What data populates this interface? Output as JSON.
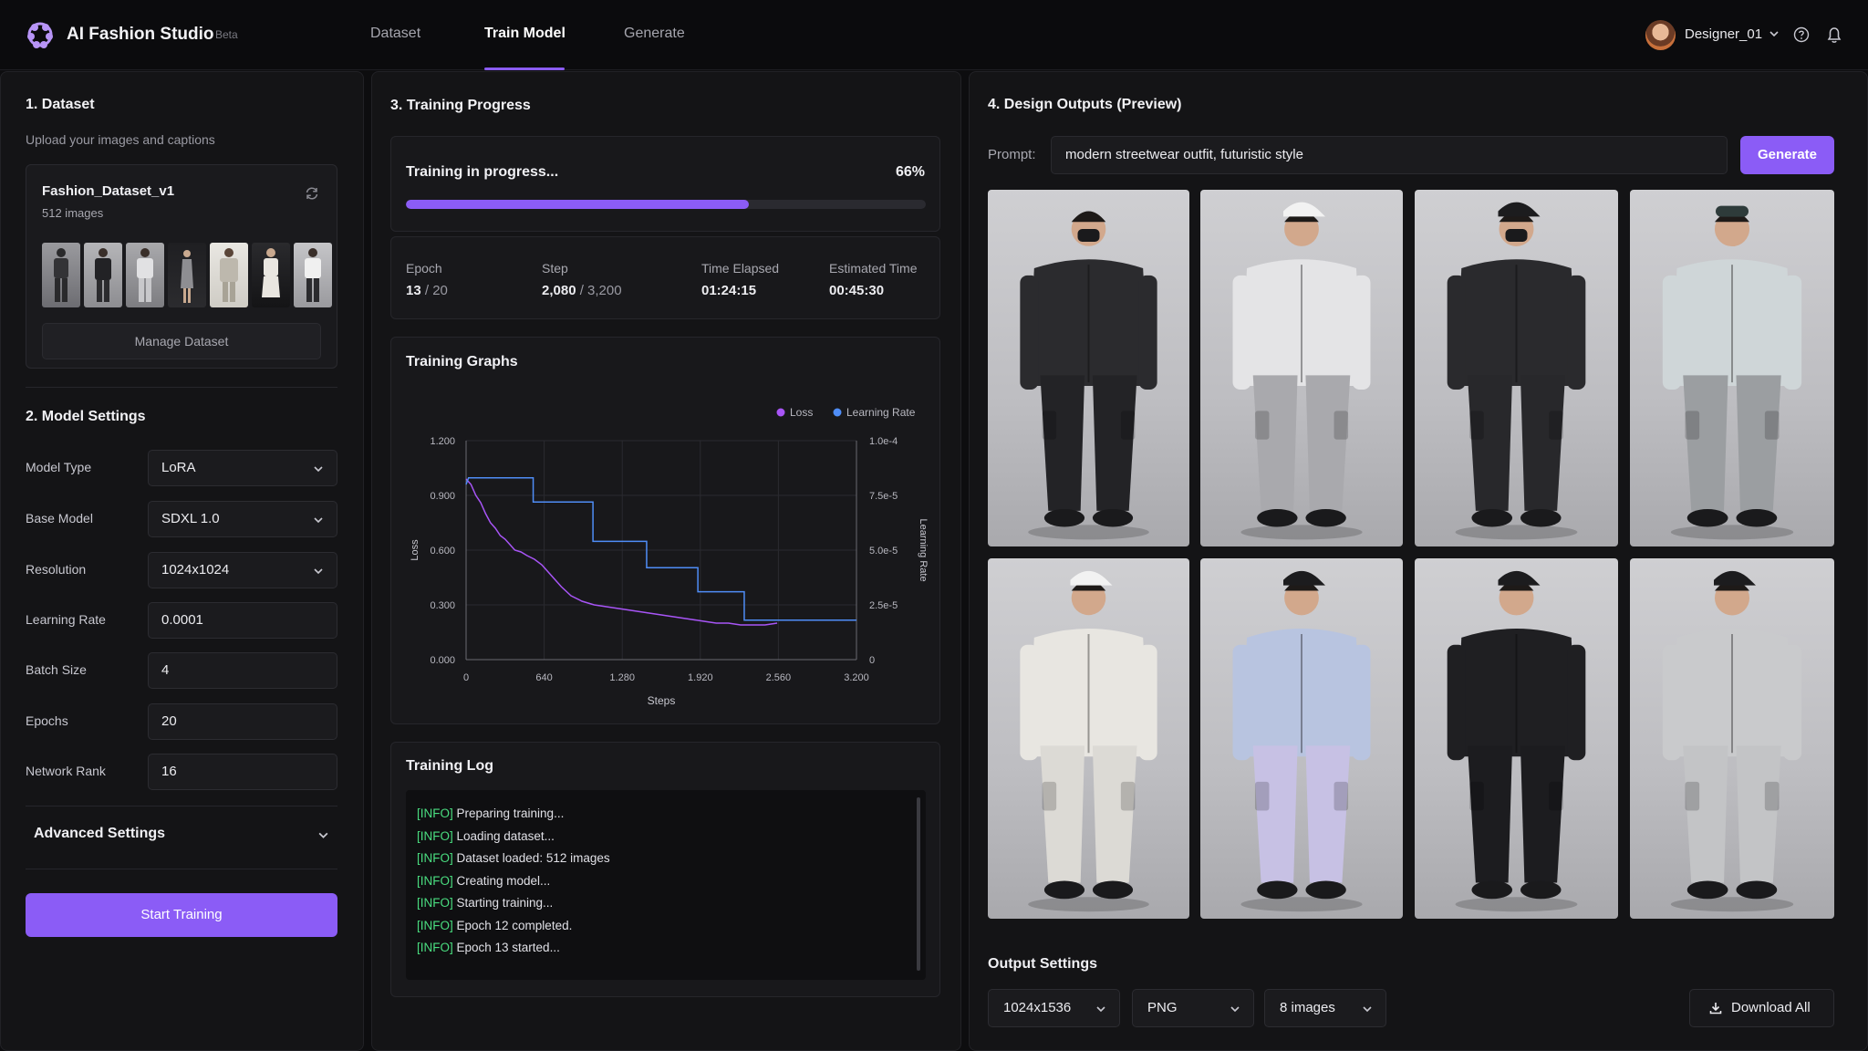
{
  "header": {
    "app_title": "AI Fashion Studio",
    "beta": "Beta",
    "tabs": [
      "Dataset",
      "Train Model",
      "Generate"
    ],
    "active_tab": "Train Model",
    "user": "Designer_01"
  },
  "dataset": {
    "title": "1. Dataset",
    "subtitle": "Upload your images and captions",
    "name": "Fashion_Dataset_v1",
    "count": "512 images",
    "manage": "Manage Dataset"
  },
  "model_settings": {
    "title": "2. Model Settings",
    "fields": [
      {
        "label": "Model Type",
        "value": "LoRA",
        "kind": "select"
      },
      {
        "label": "Base Model",
        "value": "SDXL 1.0",
        "kind": "select"
      },
      {
        "label": "Resolution",
        "value": "1024x1024",
        "kind": "select"
      },
      {
        "label": "Learning Rate",
        "value": "0.0001",
        "kind": "input"
      },
      {
        "label": "Batch Size",
        "value": "4",
        "kind": "input"
      },
      {
        "label": "Epochs",
        "value": "20",
        "kind": "input"
      },
      {
        "label": "Network Rank",
        "value": "16",
        "kind": "input"
      }
    ],
    "advanced": "Advanced Settings",
    "start": "Start Training"
  },
  "progress": {
    "title": "3. Training Progress",
    "status": "Training in progress...",
    "percent_label": "66%",
    "percent": 0.66,
    "stats": [
      {
        "label": "Epoch",
        "value": "13",
        "total": " / 20"
      },
      {
        "label": "Step",
        "value": "2,080",
        "total": " / 3,200"
      },
      {
        "label": "Time Elapsed",
        "value": "01:24:15",
        "total": ""
      },
      {
        "label": "Estimated Time",
        "value": "00:45:30",
        "total": ""
      }
    ]
  },
  "graphs": {
    "title": "Training Graphs"
  },
  "chart_data": {
    "type": "line",
    "xlabel": "Steps",
    "ylabel": "Loss",
    "ylabel_right": "Learning Rate",
    "x_ticks": [
      "0",
      "640",
      "1.280",
      "1.920",
      "2.560",
      "3.200"
    ],
    "y_ticks_left": [
      "0.000",
      "0.300",
      "0.600",
      "0.900",
      "1.200"
    ],
    "y_ticks_right": [
      "0",
      "2.5e-5",
      "5.0e-5",
      "7.5e-5",
      "1.0e-4"
    ],
    "xlim": [
      0,
      3200
    ],
    "ylim": [
      0,
      1.2
    ],
    "ylim_right": [
      0,
      0.0001
    ],
    "legend_position": "top-right",
    "grid": true,
    "series": [
      {
        "name": "Loss",
        "color": "#a855f7",
        "axis": "left",
        "x": [
          0,
          40,
          80,
          120,
          160,
          200,
          240,
          280,
          320,
          360,
          400,
          450,
          500,
          560,
          620,
          700,
          780,
          860,
          950,
          1050,
          1150,
          1250,
          1350,
          1450,
          1550,
          1650,
          1750,
          1850,
          1950,
          2050,
          2150,
          2250,
          2350,
          2450,
          2550
        ],
        "y": [
          0.99,
          0.96,
          0.9,
          0.86,
          0.8,
          0.75,
          0.72,
          0.68,
          0.66,
          0.63,
          0.6,
          0.59,
          0.57,
          0.55,
          0.52,
          0.46,
          0.4,
          0.35,
          0.32,
          0.3,
          0.29,
          0.28,
          0.27,
          0.26,
          0.25,
          0.24,
          0.23,
          0.22,
          0.21,
          0.2,
          0.2,
          0.19,
          0.19,
          0.19,
          0.2
        ]
      },
      {
        "name": "Learning Rate",
        "color": "#4f8df7",
        "axis": "right",
        "x": [
          0,
          20,
          550,
          550,
          1040,
          1040,
          1480,
          1480,
          1900,
          1900,
          2280,
          2280,
          3200
        ],
        "y": [
          8e-05,
          8.3e-05,
          8.3e-05,
          7.2e-05,
          7.2e-05,
          5.4e-05,
          5.4e-05,
          4.2e-05,
          4.2e-05,
          3.1e-05,
          3.1e-05,
          1.8e-05,
          1.8e-05
        ]
      }
    ]
  },
  "log": {
    "title": "Training Log",
    "lines": [
      {
        "tag": "[INFO]",
        "text": " Preparing training..."
      },
      {
        "tag": "[INFO]",
        "text": " Loading dataset..."
      },
      {
        "tag": "[INFO]",
        "text": " Dataset loaded: 512 images"
      },
      {
        "tag": "[INFO]",
        "text": " Creating model..."
      },
      {
        "tag": "[INFO]",
        "text": " Starting training..."
      },
      {
        "tag": "[INFO]",
        "text": " Epoch 12 completed."
      },
      {
        "tag": "[INFO]",
        "text": " Epoch 13 started..."
      }
    ]
  },
  "outputs": {
    "title": "4. Design Outputs (Preview)",
    "prompt_label": "Prompt:",
    "prompt": "modern streetwear outfit, futuristic style",
    "generate": "Generate",
    "images": [
      {
        "name": "black-masked-jacket",
        "jacket": "#2b2b2e",
        "pants": "#232326",
        "head": "mask"
      },
      {
        "name": "white-jacket-cap",
        "jacket": "#e4e4e6",
        "pants": "#a9a9ad",
        "head": "cap"
      },
      {
        "name": "black-cap-mask",
        "jacket": "#2a2a2d",
        "pants": "#28282b",
        "head": "capmask"
      },
      {
        "name": "holo-goggles",
        "jacket": "#cfd6d8",
        "pants": "#9b9ea1",
        "head": "goggles"
      },
      {
        "name": "white-cap-cargo",
        "jacket": "#e8e6e1",
        "pants": "#dcdad5",
        "head": "cap"
      },
      {
        "name": "iridescent-suit",
        "jacket": "#b8c4e0",
        "pants": "#c7c1e4",
        "head": "cap"
      },
      {
        "name": "black-green-accents",
        "jacket": "#1f1f22",
        "pants": "#1c1c1f",
        "head": "cap"
      },
      {
        "name": "silver-metallic",
        "jacket": "#c9cacc",
        "pants": "#c3c4c6",
        "head": "cap"
      }
    ],
    "settings_title": "Output Settings",
    "resolution": "1024x1536",
    "format": "PNG",
    "count": "8 images",
    "download": "Download All"
  },
  "colors": {
    "accent": "#8b5cf6",
    "log_tag": "#4ade80"
  }
}
